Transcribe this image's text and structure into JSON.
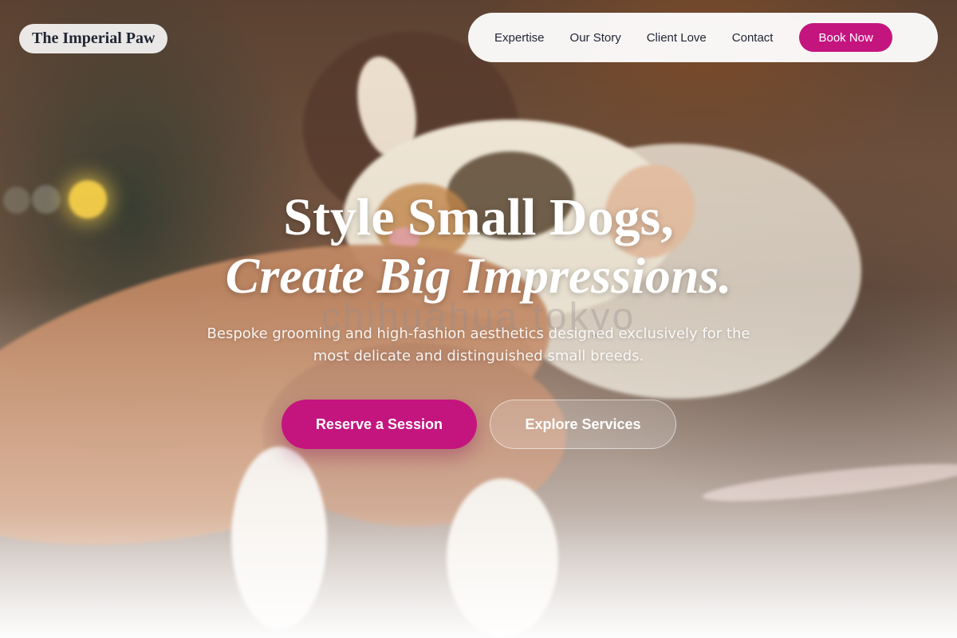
{
  "brand": {
    "name": "The Imperial Paw"
  },
  "nav": {
    "links": [
      "Expertise",
      "Our Story",
      "Client Love",
      "Contact"
    ],
    "cta_label": "Book Now"
  },
  "hero": {
    "headline_line1": "Style Small Dogs,",
    "headline_line2": "Create Big Impressions.",
    "watermark": "chihuahua tokyo",
    "subhead": "Bespoke grooming and high-fashion aesthetics designed exclusively for the most delicate and distinguished small breeds.",
    "primary_cta": "Reserve a Session",
    "secondary_cta": "Explore Services"
  },
  "colors": {
    "accent": "#c4157f",
    "logo_text": "#1f2533"
  }
}
